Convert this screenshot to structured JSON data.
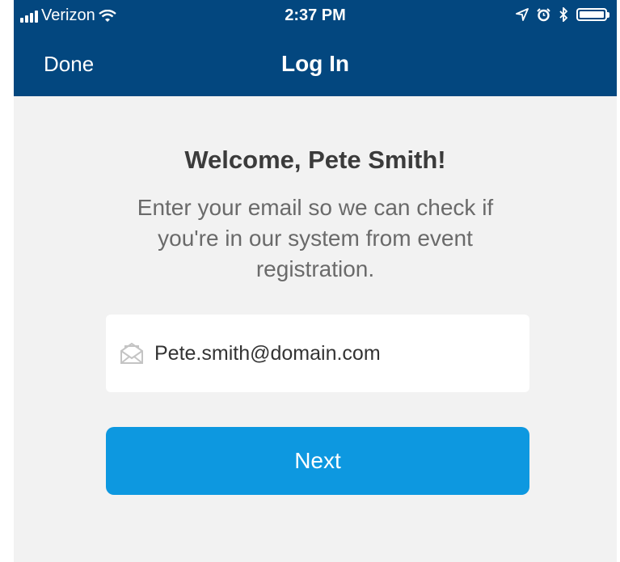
{
  "status_bar": {
    "carrier": "Verizon",
    "time": "2:37 PM",
    "icons": [
      "signal-bars-icon",
      "wifi-icon",
      "location-arrow-icon",
      "alarm-icon",
      "bluetooth-icon",
      "battery-icon"
    ]
  },
  "nav": {
    "done_label": "Done",
    "title": "Log In"
  },
  "main": {
    "welcome": "Welcome, Pete Smith!",
    "instructions": "Enter your email so we can check if you're in our system from event registration.",
    "email": {
      "value": "Pete.smith@domain.com",
      "icon": "envelope-icon"
    },
    "next_label": "Next"
  },
  "colors": {
    "nav_bg": "#03477f",
    "page_bg": "#f2f2f2",
    "button_bg": "#0d98e0"
  }
}
